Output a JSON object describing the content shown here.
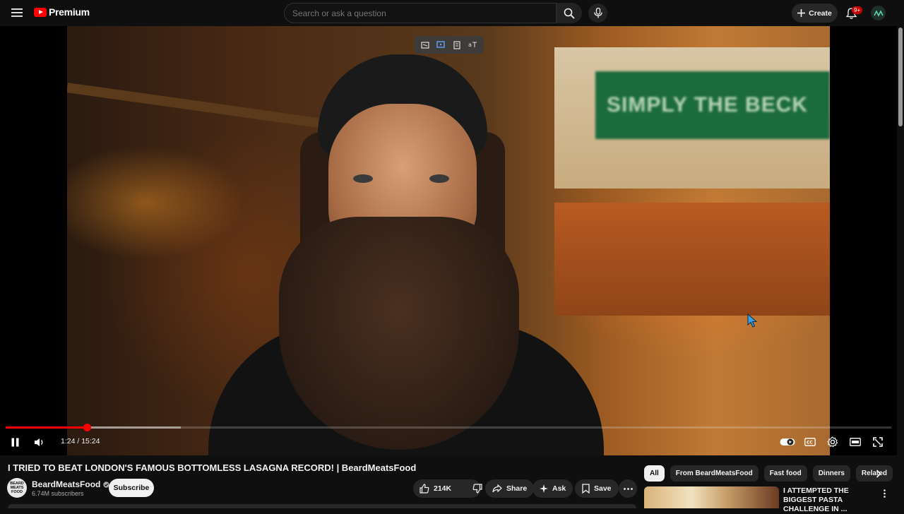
{
  "header": {
    "logo_text": "Premium",
    "search_placeholder": "Search or ask a question",
    "create_label": "Create",
    "notification_count": "9+"
  },
  "player": {
    "current_time": "1:24",
    "duration": "15:24",
    "time_display": "1:24 / 15:24",
    "progress_fraction": 0.092,
    "buffered_fraction": 0.198,
    "sign_text": "SIMPLY THE BECK"
  },
  "video": {
    "title": "I TRIED TO BEAT LONDON'S FAMOUS BOTTOMLESS LASAGNA RECORD! | BeardMeatsFood",
    "channel_name": "BeardMeatsFood",
    "channel_avatar_text": "BEARD MEATS FOOD",
    "subscribers": "6.74M subscribers",
    "subscribe_label": "Subscribe",
    "likes": "214K",
    "share_label": "Share",
    "ask_label": "Ask",
    "save_label": "Save"
  },
  "sidebar": {
    "chips": [
      "All",
      "From BeardMeatsFood",
      "Fast food",
      "Dinners",
      "Related"
    ],
    "recommendation": {
      "title": "I ATTEMPTED THE BIGGEST PASTA CHALLENGE IN ..."
    }
  },
  "colors": {
    "accent": "#ff0000",
    "background": "#0f0f0f",
    "pill": "#272727"
  }
}
